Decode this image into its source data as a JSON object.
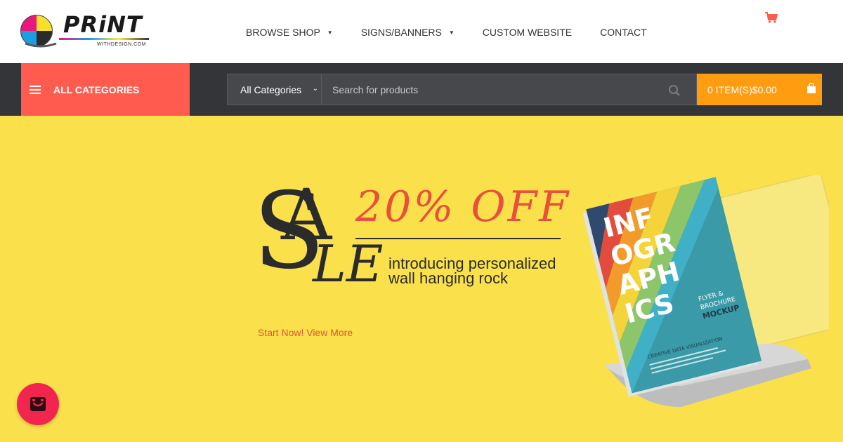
{
  "brand": {
    "logo_text": "PRiNT",
    "logo_sub": "WITHDESIGN.COM"
  },
  "nav": {
    "items": [
      {
        "label": "BROWSE SHOP",
        "has_dropdown": true
      },
      {
        "label": "SIGNS/BANNERS",
        "has_dropdown": true
      },
      {
        "label": "CUSTOM WEBSITE",
        "has_dropdown": false
      },
      {
        "label": "CONTACT",
        "has_dropdown": false
      }
    ]
  },
  "header_cart_icon": "cart-icon",
  "toolbar": {
    "categories_label": "ALL CATEGORIES",
    "category_select_value": "All Categories",
    "search_placeholder": "Search for products",
    "cart_label": "0 ITEM(S)$0.00"
  },
  "hero": {
    "sale_s": "S",
    "sale_a": "A",
    "sale_le": "LE",
    "offer": "20% OFF",
    "tagline_line1": "introducing personalized",
    "tagline_line2": "wall hanging rock",
    "cta": "Start Now! View More",
    "brochure_title": "INFOGRAPHICS",
    "brochure_sub1": "FLYER &",
    "brochure_sub2": "BROCHURE",
    "brochure_sub3": "MOCKUP",
    "brochure_tag": "CREATIVE DATA VISUALIZATION"
  },
  "colors": {
    "accent_red": "#ff5c4f",
    "cart_orange": "#ff9c10",
    "hero_yellow": "#fae14c",
    "dark_bar": "#333538",
    "chat_pink": "#f2254e"
  }
}
